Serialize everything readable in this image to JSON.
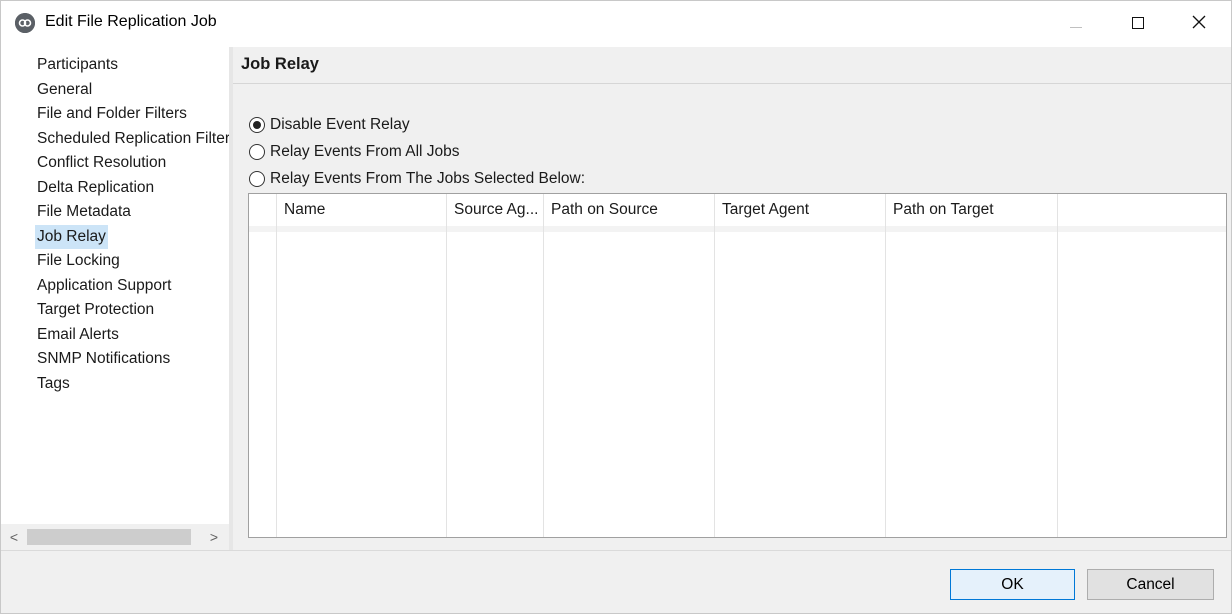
{
  "window": {
    "title": "Edit File Replication Job",
    "minimize_glyph": "—",
    "maximize_glyph": "☐",
    "close_glyph": "✕"
  },
  "sidebar": {
    "items": [
      {
        "label": "Participants"
      },
      {
        "label": "General"
      },
      {
        "label": "File and Folder Filters"
      },
      {
        "label": "Scheduled Replication Filters"
      },
      {
        "label": "Conflict Resolution"
      },
      {
        "label": "Delta Replication"
      },
      {
        "label": "File Metadata"
      },
      {
        "label": "Job Relay"
      },
      {
        "label": "File Locking"
      },
      {
        "label": "Application Support"
      },
      {
        "label": "Target Protection"
      },
      {
        "label": "Email Alerts"
      },
      {
        "label": "SNMP Notifications"
      },
      {
        "label": "Tags"
      }
    ],
    "selected": "Job Relay",
    "scroll_left_glyph": "<",
    "scroll_right_glyph": ">"
  },
  "main": {
    "title": "Job Relay",
    "options": [
      {
        "label": "Disable Event Relay",
        "checked": true
      },
      {
        "label": "Relay Events From All Jobs",
        "checked": false
      },
      {
        "label": "Relay Events From The Jobs Selected Below:",
        "checked": false
      }
    ],
    "table": {
      "columns": [
        "",
        "Name",
        "Source Ag...",
        "Path on Source",
        "Target Agent",
        "Path on Target",
        ""
      ],
      "rows": []
    }
  },
  "footer": {
    "ok_label": "OK",
    "cancel_label": "Cancel"
  },
  "colors": {
    "selection": "#cce4f7",
    "panel_bg": "#f0f0f0",
    "default_button_border": "#0078d7"
  },
  "icons": {
    "app": "peer-logo-icon"
  }
}
